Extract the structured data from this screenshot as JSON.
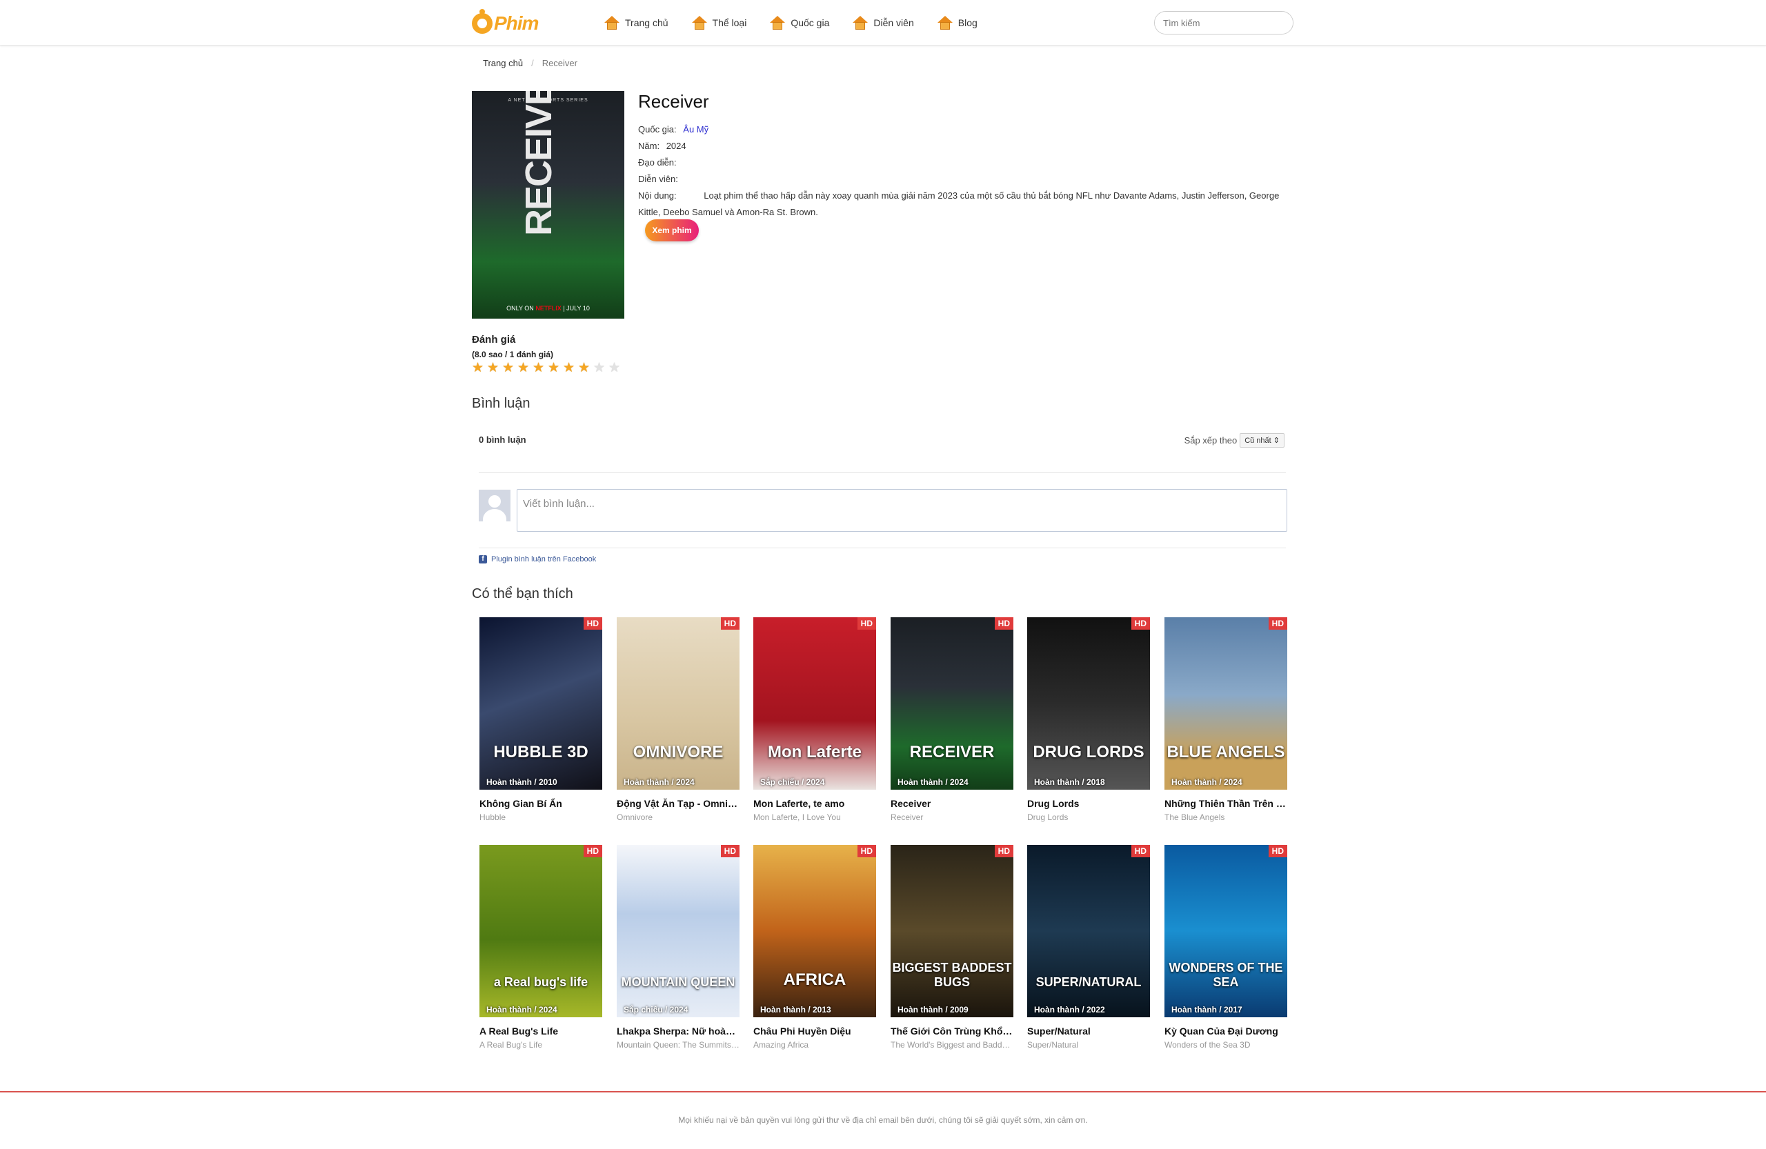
{
  "header": {
    "logo_text": "Phim",
    "nav": [
      {
        "label": "Trang chủ"
      },
      {
        "label": "Thể loại"
      },
      {
        "label": "Quốc gia"
      },
      {
        "label": "Diễn viên"
      },
      {
        "label": "Blog"
      }
    ],
    "search_placeholder": "Tìm kiếm"
  },
  "breadcrumb": {
    "home": "Trang chủ",
    "current": "Receiver"
  },
  "movie": {
    "title": "Receiver",
    "poster_text": "RECEIVER",
    "poster_tagline": "A NETFLIX SPORTS SERIES",
    "poster_brand_prefix": "ONLY ON",
    "poster_brand": "NETFLIX",
    "poster_date": "JULY 10",
    "country_label": "Quốc gia:",
    "country_value": "Âu Mỹ",
    "year_label": "Năm:",
    "year_value": "2024",
    "director_label": "Đạo diễn:",
    "director_value": "",
    "actors_label": "Diễn viên:",
    "actors_value": "",
    "content_label": "Nội dung:",
    "content_value": "Loạt phim thể thao hấp dẫn này xoay quanh mùa giải năm 2023 của một số cầu thủ bắt bóng NFL như Davante Adams, Justin Jefferson, George Kittle, Deebo Samuel và Amon-Ra St. Brown.",
    "watch_button": "Xem phim"
  },
  "rating": {
    "heading": "Đánh giá",
    "summary": "(8.0 sao / 1 đánh giá)",
    "score": 8,
    "max": 10
  },
  "comments": {
    "heading": "Bình luận",
    "count": "0 bình luận",
    "sort_label": "Sắp xếp theo",
    "sort_value": "Cũ nhất",
    "placeholder": "Viết bình luận...",
    "plugin_text": "Plugin bình luận trên Facebook"
  },
  "related": {
    "heading": "Có thể bạn thích",
    "badge": "HD",
    "items": [
      {
        "name": "Không Gian Bí Ẩn",
        "orig": "Hubble",
        "status": "Hoàn thành / 2010",
        "poster_text": "HUBBLE 3D",
        "bg": "linear-gradient(160deg,#0b1430,#3a4a6e 45%,#101018)"
      },
      {
        "name": "Động Vật Ăn Tạp - Omnivore",
        "orig": "Omnivore",
        "status": "Hoàn thành / 2024",
        "poster_text": "OMNIVORE",
        "bg": "linear-gradient(180deg,#e8dcc4,#d8c6a2 60%,#c9b38a)"
      },
      {
        "name": "Mon Laferte, te amo",
        "orig": "Mon Laferte, I Love You",
        "status": "Sắp chiếu / 2024",
        "poster_text": "Mon Laferte",
        "bg": "linear-gradient(180deg,#c81e2a,#a3141f 60%,#e9e2df)"
      },
      {
        "name": "Receiver",
        "orig": "Receiver",
        "status": "Hoàn thành / 2024",
        "poster_text": "RECEIVER",
        "bg": "linear-gradient(180deg,#1b1f24,#2a3038 40%,#1e6a2b 75%,#123d18)"
      },
      {
        "name": "Drug Lords",
        "orig": "Drug Lords",
        "status": "Hoàn thành / 2018",
        "poster_text": "DRUG LORDS",
        "bg": "linear-gradient(180deg,#111,#2b2b2b 50%,#555)"
      },
      {
        "name": "Những Thiên Thần Trên Không",
        "orig": "The Blue Angels",
        "status": "Hoàn thành / 2024",
        "poster_text": "BLUE ANGELS",
        "bg": "linear-gradient(180deg,#5a7fa8,#8aa9c8 45%,#c9a15a 80%)"
      },
      {
        "name": "A Real Bug's Life",
        "orig": "A Real Bug's Life",
        "status": "Hoàn thành / 2024",
        "poster_text": "a Real bug's life",
        "bg": "linear-gradient(180deg,#7a9a1e,#4f7a12 55%,#a7b829)"
      },
      {
        "name": "Lhakpa Sherpa: Nữ hoàng núi cao",
        "orig": "Mountain Queen: The Summits of Lhakpa Sherpa",
        "status": "Sắp chiếu / 2024",
        "poster_text": "MOUNTAIN QUEEN",
        "bg": "linear-gradient(180deg,#f4f6fa,#b9cde8 40%,#e7edf6)"
      },
      {
        "name": "Châu Phi Huyền Diệu",
        "orig": "Amazing Africa",
        "status": "Hoàn thành / 2013",
        "poster_text": "AFRICA",
        "bg": "linear-gradient(180deg,#e7b24a,#c1631a 50%,#3a2210)"
      },
      {
        "name": "Thế Giới Côn Trùng Khổng Lồ",
        "orig": "The World's Biggest and Baddest Bugs",
        "status": "Hoàn thành / 2009",
        "poster_text": "BIGGEST BADDEST BUGS",
        "bg": "linear-gradient(180deg,#2a2418,#5a4a2a 50%,#1a140c)"
      },
      {
        "name": "Super/Natural",
        "orig": "Super/Natural",
        "status": "Hoàn thành / 2022",
        "poster_text": "SUPER/NATURAL",
        "bg": "linear-gradient(180deg,#0a1a2a,#1e3a52 50%,#07121c)"
      },
      {
        "name": "Kỳ Quan Của Đại Dương",
        "orig": "Wonders of the Sea 3D",
        "status": "Hoàn thành / 2017",
        "poster_text": "WONDERS OF THE SEA",
        "bg": "linear-gradient(180deg,#0a5aa0,#1a8fd0 50%,#0a3a70)"
      }
    ]
  },
  "footer": {
    "text": "Mọi khiếu nại về bản quyền vui lòng gửi thư về địa chỉ email bên dưới, chúng tôi sẽ giải quyết sớm, xin cảm ơn."
  }
}
